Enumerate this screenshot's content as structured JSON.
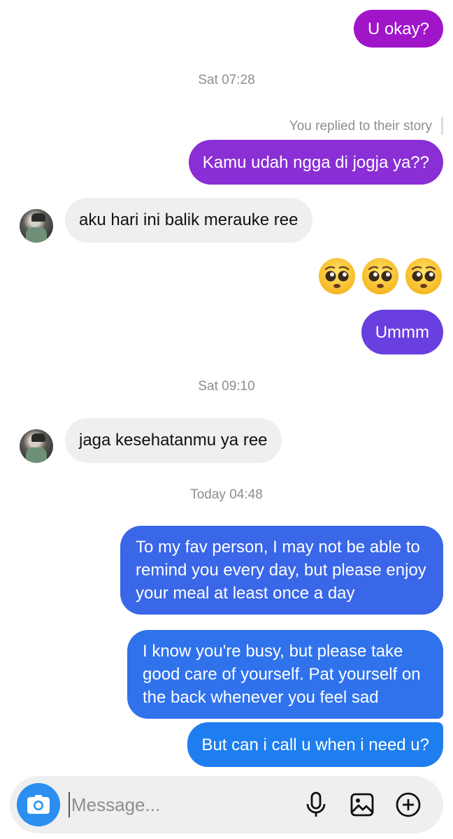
{
  "messages": {
    "m1": "U okay?",
    "ts1": "Sat 07:28",
    "reply_note": "You replied to their story",
    "m2": "Kamu udah ngga di jogja ya??",
    "m3": "aku hari ini balik merauke ree",
    "m4": "Ummm",
    "ts2": "Sat 09:10",
    "m5": "jaga kesehatanmu ya ree",
    "ts3": "Today 04:48",
    "m6": "To my fav person, I may not be able to remind you every day, but please enjoy your meal at least once a day",
    "m7": "I know you're busy, but please take good care of yourself. Pat yourself on the back whenever you feel sad",
    "m8": "But can i call u when i need u?"
  },
  "composer": {
    "placeholder": "Message..."
  },
  "icons": {
    "camera": "camera-icon",
    "mic": "microphone-icon",
    "gallery": "gallery-icon",
    "add": "plus-circle-icon",
    "emoji": "pleading-face-emoji"
  },
  "colors": {
    "purple_top": "#a115c9",
    "purple_mid": "#8a2ed6",
    "violet": "#6a3fe0",
    "blue_mid": "#3a66e8",
    "blue_bottom": "#1e7ef0",
    "incoming_bg": "#efefef",
    "camera_button": "#2b8ef0"
  }
}
